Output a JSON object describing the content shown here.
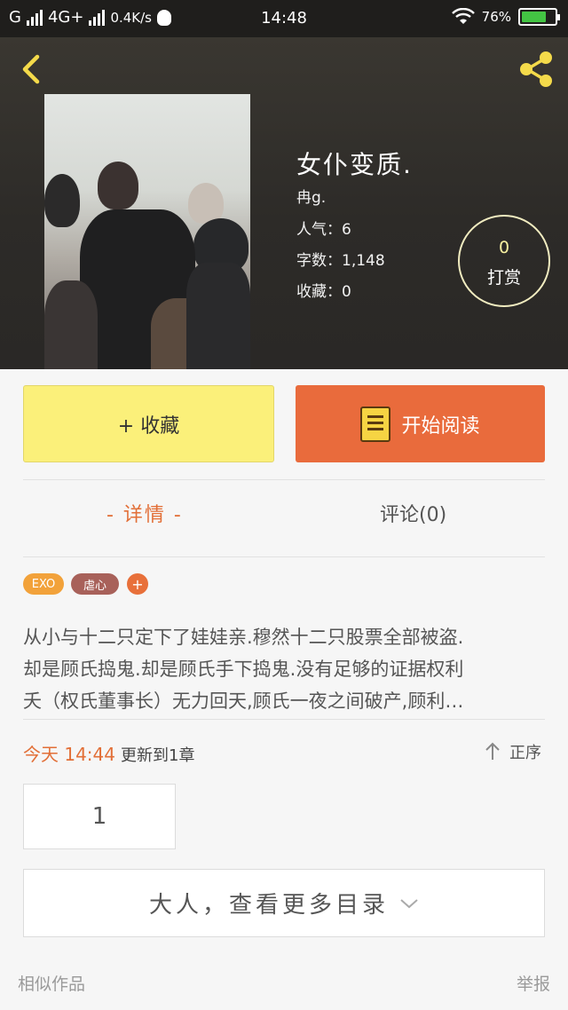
{
  "status_bar": {
    "carrier": "G",
    "network": "4G+",
    "speed": "0.4K/s",
    "time": "14:48",
    "battery": "76%",
    "battery_level": 0.76
  },
  "header": {
    "book_title": "女仆变质.",
    "author": "冉g.",
    "popularity": "人气：6",
    "word_count": "字数：1,148",
    "favorites": "收藏：0",
    "reward_count": "0",
    "reward_label": "打赏"
  },
  "actions": {
    "collect_label": "+ 收藏",
    "read_label": "开始阅读"
  },
  "tabs": {
    "details": "- 详情 -",
    "comments": "评论(0)"
  },
  "tags": [
    "EXO",
    "虐心",
    "+"
  ],
  "description": [
    "从小与十二只定下了娃娃亲.穆然十二只股票全部被盗.",
    "却是顾氏捣鬼.却是顾氏手下捣鬼.没有足够的证据权利",
    "夭（权氏董事长）无力回天,顾氏一夜之间破产,顾利…"
  ],
  "update": {
    "today": "今天 14:44",
    "rest": "更新到1章",
    "sort_label": "正序"
  },
  "chapter": {
    "number": "1"
  },
  "more_catalog": "大人，查看更多目录",
  "footer": {
    "similar": "相似作品",
    "report": "举报"
  },
  "colors": {
    "accent": "#e26f37",
    "collect_bg": "#fbf07a",
    "read_bg": "#e96b3c",
    "icon_yellow": "#f6d443"
  }
}
